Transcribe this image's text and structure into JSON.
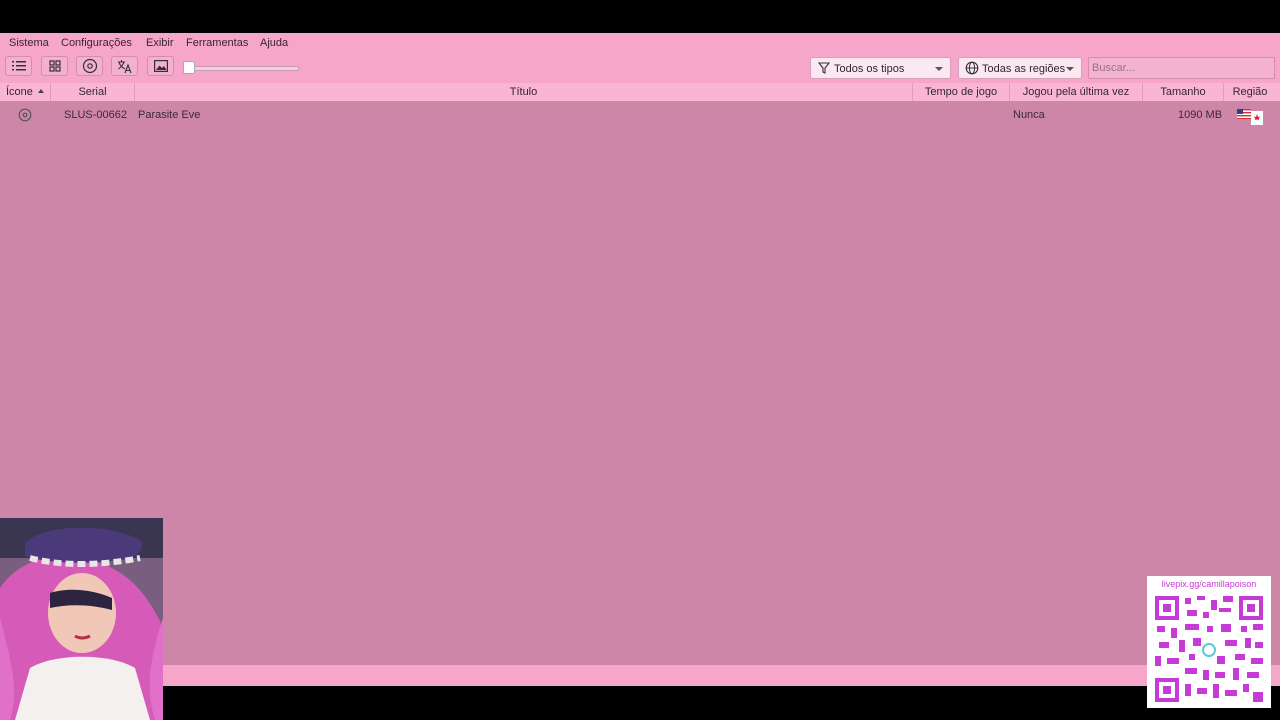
{
  "menu": [
    "Sistema",
    "Configurações",
    "Exibir",
    "Ferramentas",
    "Ajuda"
  ],
  "toolbar": {
    "buttons": [
      "list-view",
      "grid-view",
      "disc",
      "translate",
      "image"
    ],
    "filter_types": "Todos os tipos",
    "filter_regions": "Todas as regiões",
    "search_placeholder": "Buscar..."
  },
  "table": {
    "columns": [
      "Ícone",
      "Serial",
      "Título",
      "Tempo de jogo",
      "Jogou pela última vez",
      "Tamanho",
      "Região"
    ],
    "rows": [
      {
        "icon": "disc-icon",
        "serial": "SLUS-00662",
        "title": "Parasite Eve",
        "playtime": "",
        "last_played": "Nunca",
        "size": "1090 MB",
        "region": "us-canada-flags"
      }
    ]
  },
  "overlay": {
    "qr_url": "livepix.gg/camillapoison"
  },
  "colors": {
    "window_bg": "#ce86a8",
    "bars": "#f6a6c9",
    "header": "#f8b6d3",
    "qr_accent": "#c63bd6"
  }
}
